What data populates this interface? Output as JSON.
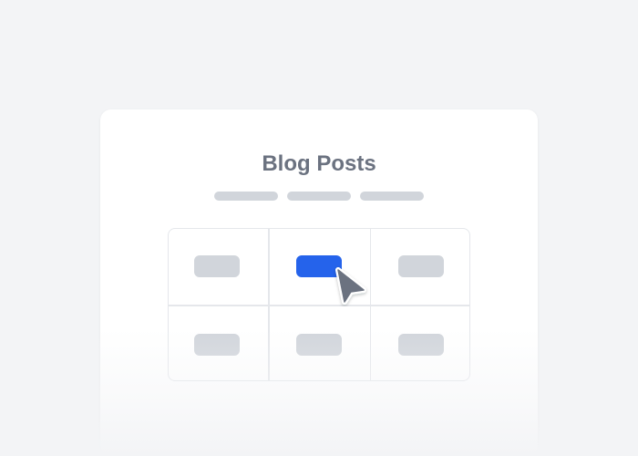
{
  "page": {
    "title": "Blog Posts"
  },
  "tabs": {
    "count": 3,
    "style": "placeholder-pills"
  },
  "grid": {
    "rows": 2,
    "columns": 3,
    "buttons": [
      {
        "state": "default"
      },
      {
        "state": "selected"
      },
      {
        "state": "default"
      },
      {
        "state": "default"
      },
      {
        "state": "default"
      },
      {
        "state": "default"
      }
    ]
  },
  "colors": {
    "background": "#f3f4f6",
    "card": "#ffffff",
    "title_text": "#6b7280",
    "placeholder": "#d1d5db",
    "accent": "#2563eb",
    "grid_border": "#e5e7eb"
  },
  "cursor": {
    "icon": "arrow-pointer-icon"
  }
}
